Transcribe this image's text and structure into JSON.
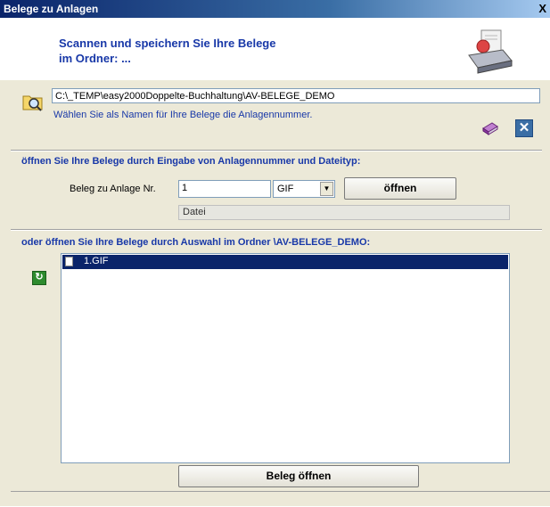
{
  "window": {
    "title": "Belege zu Anlagen",
    "close_glyph": "X"
  },
  "header": {
    "line1": "Scannen und speichern Sie Ihre Belege",
    "line2": "im Ordner: ...",
    "icon": "scanner-icon"
  },
  "folder": {
    "path": "C:\\_TEMP\\easy2000Doppelte-Buchhaltung\\AV-BELEGE_DEMO",
    "hint": "Wählen Sie als Namen für Ihre Belege die Anlagennummer.",
    "close_glyph": "✕"
  },
  "open_by_number": {
    "heading": "öffnen Sie Ihre Belege durch Eingabe von Anlagennummer und Dateityp:",
    "label": "Beleg zu Anlage Nr.",
    "number_value": "1",
    "type_value": "GIF",
    "open_label": "öffnen",
    "file_value": "Datei"
  },
  "open_by_folder": {
    "heading": "oder öffnen Sie Ihre Belege durch Auswahl im Ordner \\AV-BELEGE_DEMO:",
    "files": [
      {
        "name": "1.GIF",
        "selected": true
      }
    ],
    "open_label": "Beleg öffnen"
  },
  "colors": {
    "accent": "#1838a8",
    "selection": "#0a246a",
    "panel": "#ece9d8"
  }
}
